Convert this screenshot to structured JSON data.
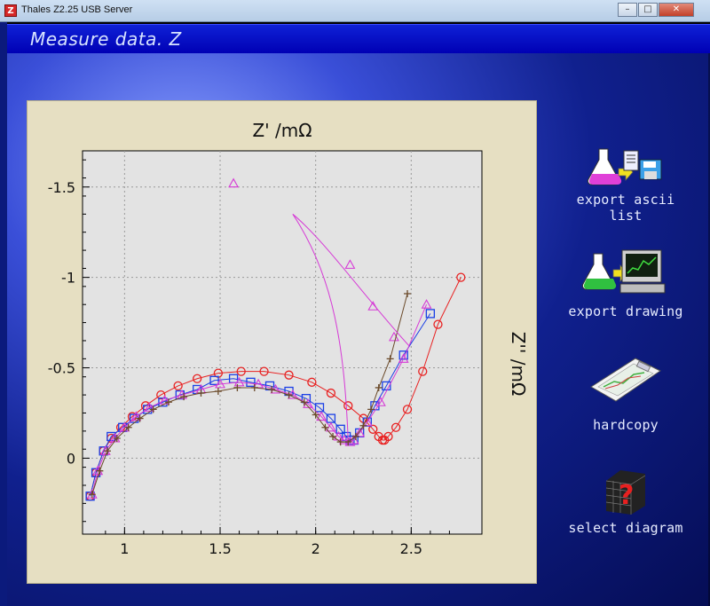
{
  "window": {
    "title": "Thales Z2.25 USB Server",
    "app_icon": "Z"
  },
  "header": {
    "title": "Measure data. Z"
  },
  "actions": [
    {
      "label": "export ascii list",
      "icon": "export-ascii-icon"
    },
    {
      "label": "export drawing",
      "icon": "export-drawing-icon"
    },
    {
      "label": "hardcopy",
      "icon": "hardcopy-icon"
    },
    {
      "label": "select diagram",
      "icon": "select-diagram-icon"
    }
  ],
  "chart_data": {
    "type": "scatter",
    "title": "Z' /mΩ",
    "xlabel": "Z' /mΩ",
    "ylabel": "Z'' /mΩ",
    "xlim": [
      0.78,
      2.87
    ],
    "ylim": [
      -1.7,
      0.42
    ],
    "y_inverted": true,
    "xticks": [
      1,
      1.5,
      2,
      2.5
    ],
    "xtick_labels": [
      "1",
      "1.5",
      "2",
      "2.5"
    ],
    "yticks": [
      -1.5,
      -1,
      -0.5,
      0
    ],
    "ytick_labels": [
      "-1.5",
      "-1",
      "-0.5",
      "0"
    ],
    "grid": true,
    "series": [
      {
        "marker": "circle",
        "color": "#e82020",
        "x": [
          0.82,
          0.85,
          0.89,
          0.93,
          0.98,
          1.04,
          1.11,
          1.19,
          1.28,
          1.38,
          1.49,
          1.61,
          1.73,
          1.86,
          1.98,
          2.08,
          2.17,
          2.25,
          2.3,
          2.33,
          2.35,
          2.36,
          2.38,
          2.42,
          2.48,
          2.56,
          2.64,
          2.76
        ],
        "y": [
          0.21,
          0.08,
          -0.04,
          -0.11,
          -0.17,
          -0.23,
          -0.29,
          -0.35,
          -0.4,
          -0.44,
          -0.47,
          -0.48,
          -0.48,
          -0.46,
          -0.42,
          -0.36,
          -0.29,
          -0.22,
          -0.16,
          -0.12,
          -0.1,
          -0.1,
          -0.12,
          -0.17,
          -0.27,
          -0.48,
          -0.74,
          -1.0
        ]
      },
      {
        "marker": "square",
        "color": "#1a3fe6",
        "x": [
          0.82,
          0.85,
          0.89,
          0.93,
          0.99,
          1.05,
          1.12,
          1.2,
          1.29,
          1.38,
          1.47,
          1.57,
          1.66,
          1.76,
          1.86,
          1.95,
          2.02,
          2.08,
          2.13,
          2.16,
          2.18,
          2.2,
          2.23,
          2.27,
          2.31,
          2.37,
          2.46,
          2.6
        ],
        "y": [
          0.21,
          0.08,
          -0.04,
          -0.12,
          -0.17,
          -0.22,
          -0.27,
          -0.31,
          -0.35,
          -0.38,
          -0.43,
          -0.44,
          -0.42,
          -0.4,
          -0.37,
          -0.33,
          -0.28,
          -0.22,
          -0.16,
          -0.12,
          -0.1,
          -0.1,
          -0.14,
          -0.2,
          -0.29,
          -0.4,
          -0.57,
          -0.8
        ]
      },
      {
        "marker": "triangle",
        "color": "#d63ad6",
        "x": [
          0.83,
          0.86,
          0.9,
          0.95,
          1.0,
          1.06,
          1.13,
          1.21,
          1.3,
          1.4,
          1.5,
          1.6,
          1.7,
          1.79,
          1.88,
          1.96,
          2.03,
          2.08,
          2.12,
          2.15,
          2.18,
          2.2,
          2.23,
          2.27,
          2.34,
          2.46,
          2.58,
          1.57,
          2.18,
          2.3,
          2.41
        ],
        "y": [
          0.2,
          0.07,
          -0.04,
          -0.11,
          -0.17,
          -0.23,
          -0.28,
          -0.32,
          -0.35,
          -0.38,
          -0.41,
          -0.42,
          -0.41,
          -0.38,
          -0.35,
          -0.3,
          -0.23,
          -0.17,
          -0.12,
          -0.1,
          -0.09,
          -0.1,
          -0.14,
          -0.2,
          -0.31,
          -0.55,
          -0.85,
          -1.52,
          -1.07,
          -0.84,
          -0.67
        ]
      },
      {
        "marker": "plus",
        "color": "#6b4a2a",
        "x": [
          0.83,
          0.87,
          0.91,
          0.96,
          1.02,
          1.08,
          1.15,
          1.23,
          1.31,
          1.4,
          1.49,
          1.59,
          1.68,
          1.77,
          1.86,
          1.94,
          2.0,
          2.05,
          2.09,
          2.13,
          2.17,
          2.21,
          2.25,
          2.29,
          2.33,
          2.39,
          2.48
        ],
        "y": [
          0.2,
          0.07,
          -0.04,
          -0.11,
          -0.17,
          -0.22,
          -0.27,
          -0.31,
          -0.34,
          -0.36,
          -0.37,
          -0.39,
          -0.39,
          -0.38,
          -0.35,
          -0.31,
          -0.24,
          -0.17,
          -0.12,
          -0.09,
          -0.09,
          -0.12,
          -0.18,
          -0.27,
          -0.39,
          -0.55,
          -0.91
        ]
      }
    ]
  }
}
